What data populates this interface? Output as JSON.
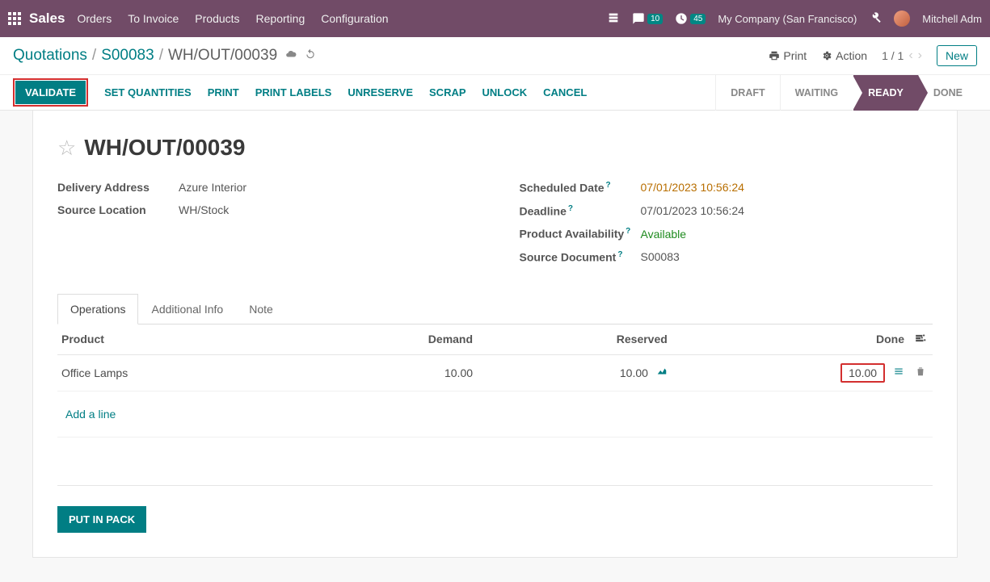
{
  "topbar": {
    "brand": "Sales",
    "nav": [
      "Orders",
      "To Invoice",
      "Products",
      "Reporting",
      "Configuration"
    ],
    "messages_count": "10",
    "activities_count": "45",
    "company": "My Company (San Francisco)",
    "user": "Mitchell Adm"
  },
  "breadcrumb": {
    "items": [
      "Quotations",
      "S00083"
    ],
    "current": "WH/OUT/00039",
    "print": "Print",
    "action": "Action",
    "pager": "1 / 1",
    "new": "New"
  },
  "actions": {
    "validate": "VALIDATE",
    "set_qty": "SET QUANTITIES",
    "print": "PRINT",
    "print_labels": "PRINT LABELS",
    "unreserve": "UNRESERVE",
    "scrap": "SCRAP",
    "unlock": "UNLOCK",
    "cancel": "CANCEL"
  },
  "status": {
    "draft": "DRAFT",
    "waiting": "WAITING",
    "ready": "READY",
    "done": "DONE"
  },
  "record": {
    "name": "WH/OUT/00039",
    "labels": {
      "delivery_address": "Delivery Address",
      "source_location": "Source Location",
      "scheduled_date": "Scheduled Date",
      "deadline": "Deadline",
      "availability": "Product Availability",
      "source_doc": "Source Document"
    },
    "delivery_address": "Azure Interior",
    "source_location": "WH/Stock",
    "scheduled_date": "07/01/2023 10:56:24",
    "deadline": "07/01/2023 10:56:24",
    "availability": "Available",
    "source_doc": "S00083"
  },
  "tabs": {
    "operations": "Operations",
    "additional": "Additional Info",
    "note": "Note"
  },
  "table": {
    "headers": {
      "product": "Product",
      "demand": "Demand",
      "reserved": "Reserved",
      "done": "Done"
    },
    "rows": [
      {
        "product": "Office Lamps",
        "demand": "10.00",
        "reserved": "10.00",
        "done": "10.00"
      }
    ],
    "add_line": "Add a line"
  },
  "footer": {
    "put_in_pack": "PUT IN PACK"
  }
}
